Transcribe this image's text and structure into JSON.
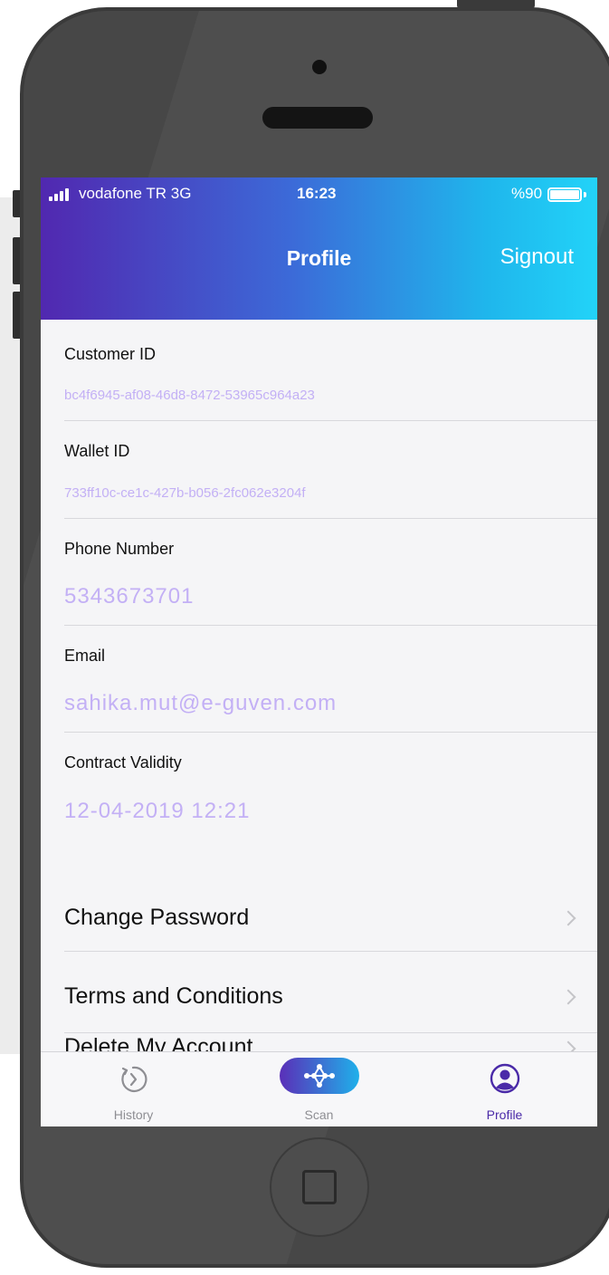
{
  "status_bar": {
    "carrier": "vodafone TR  3G",
    "time": "16:23",
    "battery": "%90"
  },
  "header": {
    "title": "Profile",
    "signout_label": "Signout"
  },
  "fields": [
    {
      "label": "Customer ID",
      "value": "bc4f6945-af08-46d8-8472-53965c964a23"
    },
    {
      "label": "Wallet ID",
      "value": "733ff10c-ce1c-427b-b056-2fc062e3204f"
    },
    {
      "label": "Phone Number",
      "value": "5343673701"
    },
    {
      "label": "Email",
      "value": "sahika.mut@e-guven.com"
    },
    {
      "label": "Contract Validity",
      "value": "12-04-2019 12:21"
    }
  ],
  "menu": [
    {
      "label": "Change Password"
    },
    {
      "label": "Terms and Conditions"
    },
    {
      "label": "Delete My Account"
    }
  ],
  "tabs": [
    {
      "label": "History",
      "icon": "history-icon"
    },
    {
      "label": "Scan",
      "icon": "scan-icon"
    },
    {
      "label": "Profile",
      "icon": "profile-icon",
      "active": true
    }
  ],
  "colors": {
    "accent": "#4a2aa8",
    "value_text": "#c3b0f5",
    "header_start": "#5128b0",
    "header_end": "#22d3f8"
  }
}
